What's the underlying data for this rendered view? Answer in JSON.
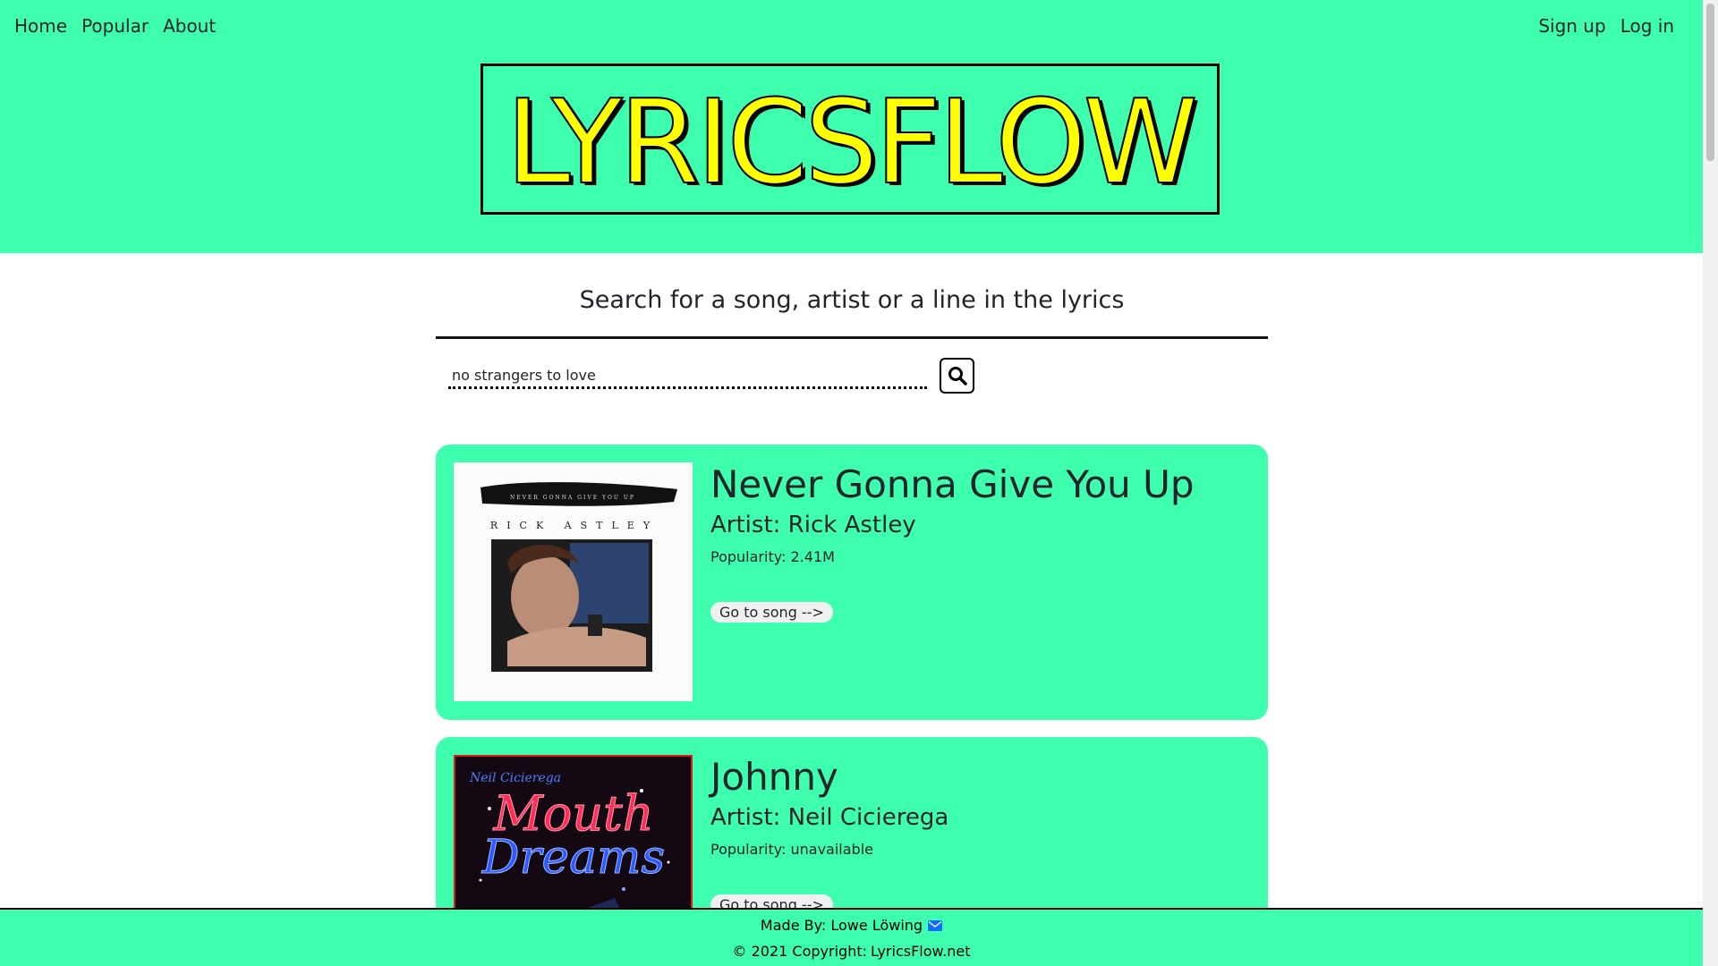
{
  "nav": {
    "left": [
      "Home",
      "Popular",
      "About"
    ],
    "right": [
      "Sign up",
      "Log in"
    ]
  },
  "logo": {
    "text": "LYRICSFLOW"
  },
  "search": {
    "heading": "Search for a song, artist or a line in the lyrics",
    "value": "no strangers to love",
    "button_icon": "search-icon"
  },
  "results": [
    {
      "title": "Never Gonna Give You Up",
      "artist": "Artist: Rick Astley",
      "popularity": "Popularity: 2.41M",
      "button": "Go to song -->",
      "cover": {
        "top_text": "NEVER GONNA GIVE YOU UP",
        "artist_text": "RICK ASTLEY"
      }
    },
    {
      "title": "Johnny",
      "artist": "Artist: Neil Cicierega",
      "popularity": "Popularity: unavailable",
      "button": "Go to song -->",
      "cover": {
        "top_text": "Neil Cicierega",
        "line1": "Mouth",
        "line2": "Dreams"
      }
    }
  ],
  "footer": {
    "made_by": "Made By: Lowe Löwing",
    "copyright": "© 2021 Copyright:",
    "site": "LyricsFlow.net",
    "mail_icon": "envelope-icon"
  },
  "colors": {
    "accent": "#3dffae",
    "logo_fill": "#ffff00",
    "mail_icon": "#0d6efd"
  }
}
